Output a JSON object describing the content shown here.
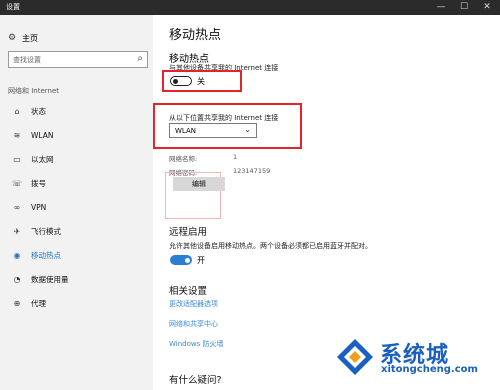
{
  "window": {
    "title": "设置",
    "min": "—",
    "max": "☐",
    "close": "✕"
  },
  "sidebar": {
    "home_label": "主页",
    "search_placeholder": "查找设置",
    "section_label": "网络和 Internet",
    "items": [
      {
        "label": "状态",
        "icon": "status-icon",
        "glyph": "⌂"
      },
      {
        "label": "WLAN",
        "icon": "wifi-icon",
        "glyph": "≋"
      },
      {
        "label": "以太网",
        "icon": "ethernet-icon",
        "glyph": "▭"
      },
      {
        "label": "拨号",
        "icon": "dialup-icon",
        "glyph": "☏"
      },
      {
        "label": "VPN",
        "icon": "vpn-icon",
        "glyph": "∞"
      },
      {
        "label": "飞行模式",
        "icon": "airplane-icon",
        "glyph": "✈"
      },
      {
        "label": "移动热点",
        "icon": "hotspot-icon",
        "glyph": "◉",
        "active": true
      },
      {
        "label": "数据使用量",
        "icon": "data-usage-icon",
        "glyph": "◔"
      },
      {
        "label": "代理",
        "icon": "proxy-icon",
        "glyph": "⊕"
      }
    ]
  },
  "main": {
    "page_title": "移动热点",
    "hotspot": {
      "title": "移动热点",
      "description": "与其他设备共享我的 Internet 连接",
      "toggle_state": "关"
    },
    "share_from": {
      "label": "从以下位置共享我的 Internet 连接",
      "selected": "WLAN"
    },
    "network_name_label": "网络名称:",
    "network_name_value": "1",
    "network_password_label": "网络密码:",
    "network_password_value": "123147159",
    "edit_button": "编辑",
    "remote": {
      "title": "远程启用",
      "description": "允许其他设备启用移动热点。两个设备必须都已启用蓝牙并配对。",
      "toggle_state": "开"
    },
    "related": {
      "title": "相关设置",
      "links": [
        "更改适配器选项",
        "网络和共享中心",
        "Windows 防火墙"
      ]
    },
    "question_title": "有什么疑问?"
  },
  "watermark": {
    "brand": "系统城",
    "url": "xitongcheng.com"
  },
  "colors": {
    "accent": "#1f6fbf",
    "highlight_box": "#e0262a",
    "watermark": "#1a60c0"
  }
}
